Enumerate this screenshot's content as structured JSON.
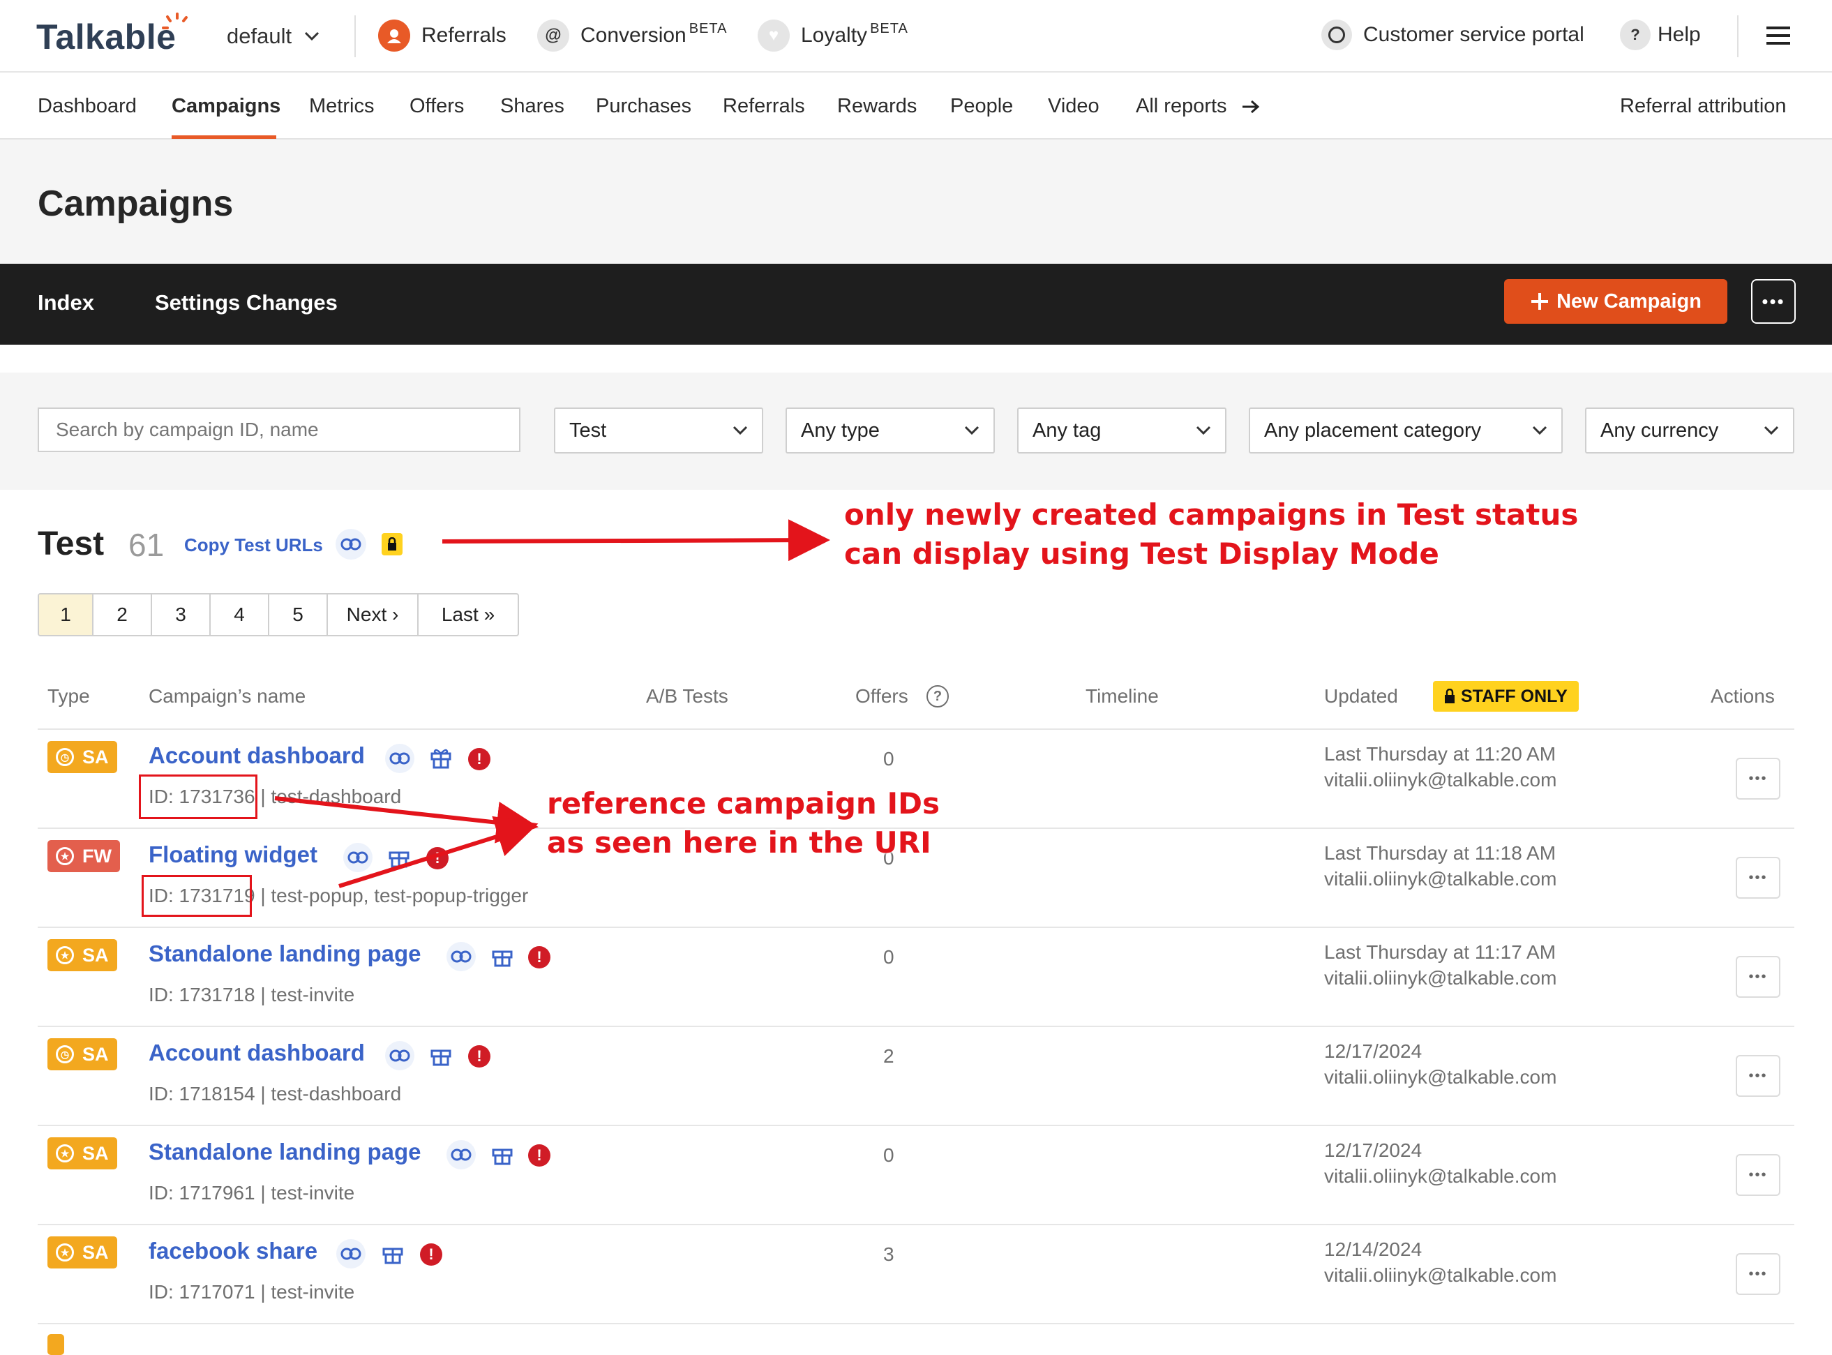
{
  "topbar": {
    "logo": "Talkable",
    "site_select": "default",
    "products": [
      {
        "label": "Referrals",
        "sup": ""
      },
      {
        "label": "Conversion",
        "sup": "BETA"
      },
      {
        "label": "Loyalty",
        "sup": "BETA"
      }
    ],
    "portal": "Customer service portal",
    "help": "Help"
  },
  "subnav": {
    "items": [
      "Dashboard",
      "Campaigns",
      "Metrics",
      "Offers",
      "Shares",
      "Purchases",
      "Referrals",
      "Rewards",
      "People",
      "Video",
      "All reports"
    ],
    "active": "Campaigns",
    "right": "Referral attribution"
  },
  "page": {
    "title": "Campaigns",
    "tabs": [
      "Index",
      "Settings Changes"
    ],
    "new_campaign": "New Campaign"
  },
  "filters": {
    "search_placeholder": "Search by campaign ID, name",
    "status": "Test",
    "type": "Any type",
    "tag": "Any tag",
    "placement": "Any placement category",
    "currency": "Any currency"
  },
  "section": {
    "title": "Test",
    "count": "61",
    "copy_urls": "Copy Test URLs"
  },
  "pagination": [
    "1",
    "2",
    "3",
    "4",
    "5",
    "Next ›",
    "Last »"
  ],
  "table": {
    "headers": {
      "type": "Type",
      "name": "Campaign’s name",
      "ab": "A/B Tests",
      "offers": "Offers",
      "timeline": "Timeline",
      "updated": "Updated",
      "staff_only": "STAFF ONLY",
      "actions": "Actions"
    },
    "rows": [
      {
        "type": "SA",
        "name": "Account dashboard",
        "meta": "ID: 1731736 | test-dashboard",
        "offers": "0",
        "updated": "Last Thursday at 11:20 AM",
        "user": "vitalii.oliinyk@talkable.com"
      },
      {
        "type": "FW",
        "name": "Floating widget",
        "meta": "ID: 1731719 | test-popup, test-popup-trigger",
        "offers": "0",
        "updated": "Last Thursday at 11:18 AM",
        "user": "vitalii.oliinyk@talkable.com"
      },
      {
        "type": "SA",
        "name": "Standalone landing page",
        "meta": "ID: 1731718 | test-invite",
        "offers": "0",
        "updated": "Last Thursday at 11:17 AM",
        "user": "vitalii.oliinyk@talkable.com"
      },
      {
        "type": "SA",
        "name": "Account dashboard",
        "meta": "ID: 1718154 | test-dashboard",
        "offers": "2",
        "updated": "12/17/2024",
        "user": "vitalii.oliinyk@talkable.com"
      },
      {
        "type": "SA",
        "name": "Standalone landing page",
        "meta": "ID: 1717961 | test-invite",
        "offers": "0",
        "updated": "12/17/2024",
        "user": "vitalii.oliinyk@talkable.com"
      },
      {
        "type": "SA",
        "name": "facebook share",
        "meta": "ID: 1717071 | test-invite",
        "offers": "3",
        "updated": "12/14/2024",
        "user": "vitalii.oliinyk@talkable.com"
      }
    ]
  },
  "annotations": {
    "a1_line1": "only newly created campaigns in Test status",
    "a1_line2": "can display using Test Display Mode",
    "a2_line1": "reference campaign IDs",
    "a2_line2": "as seen here in the URI"
  },
  "colors": {
    "accent": "#e85a27",
    "link": "#3a63c8",
    "annotation": "#e3141b",
    "sa_badge": "#f3a81f",
    "fw_badge": "#e35f4d"
  }
}
